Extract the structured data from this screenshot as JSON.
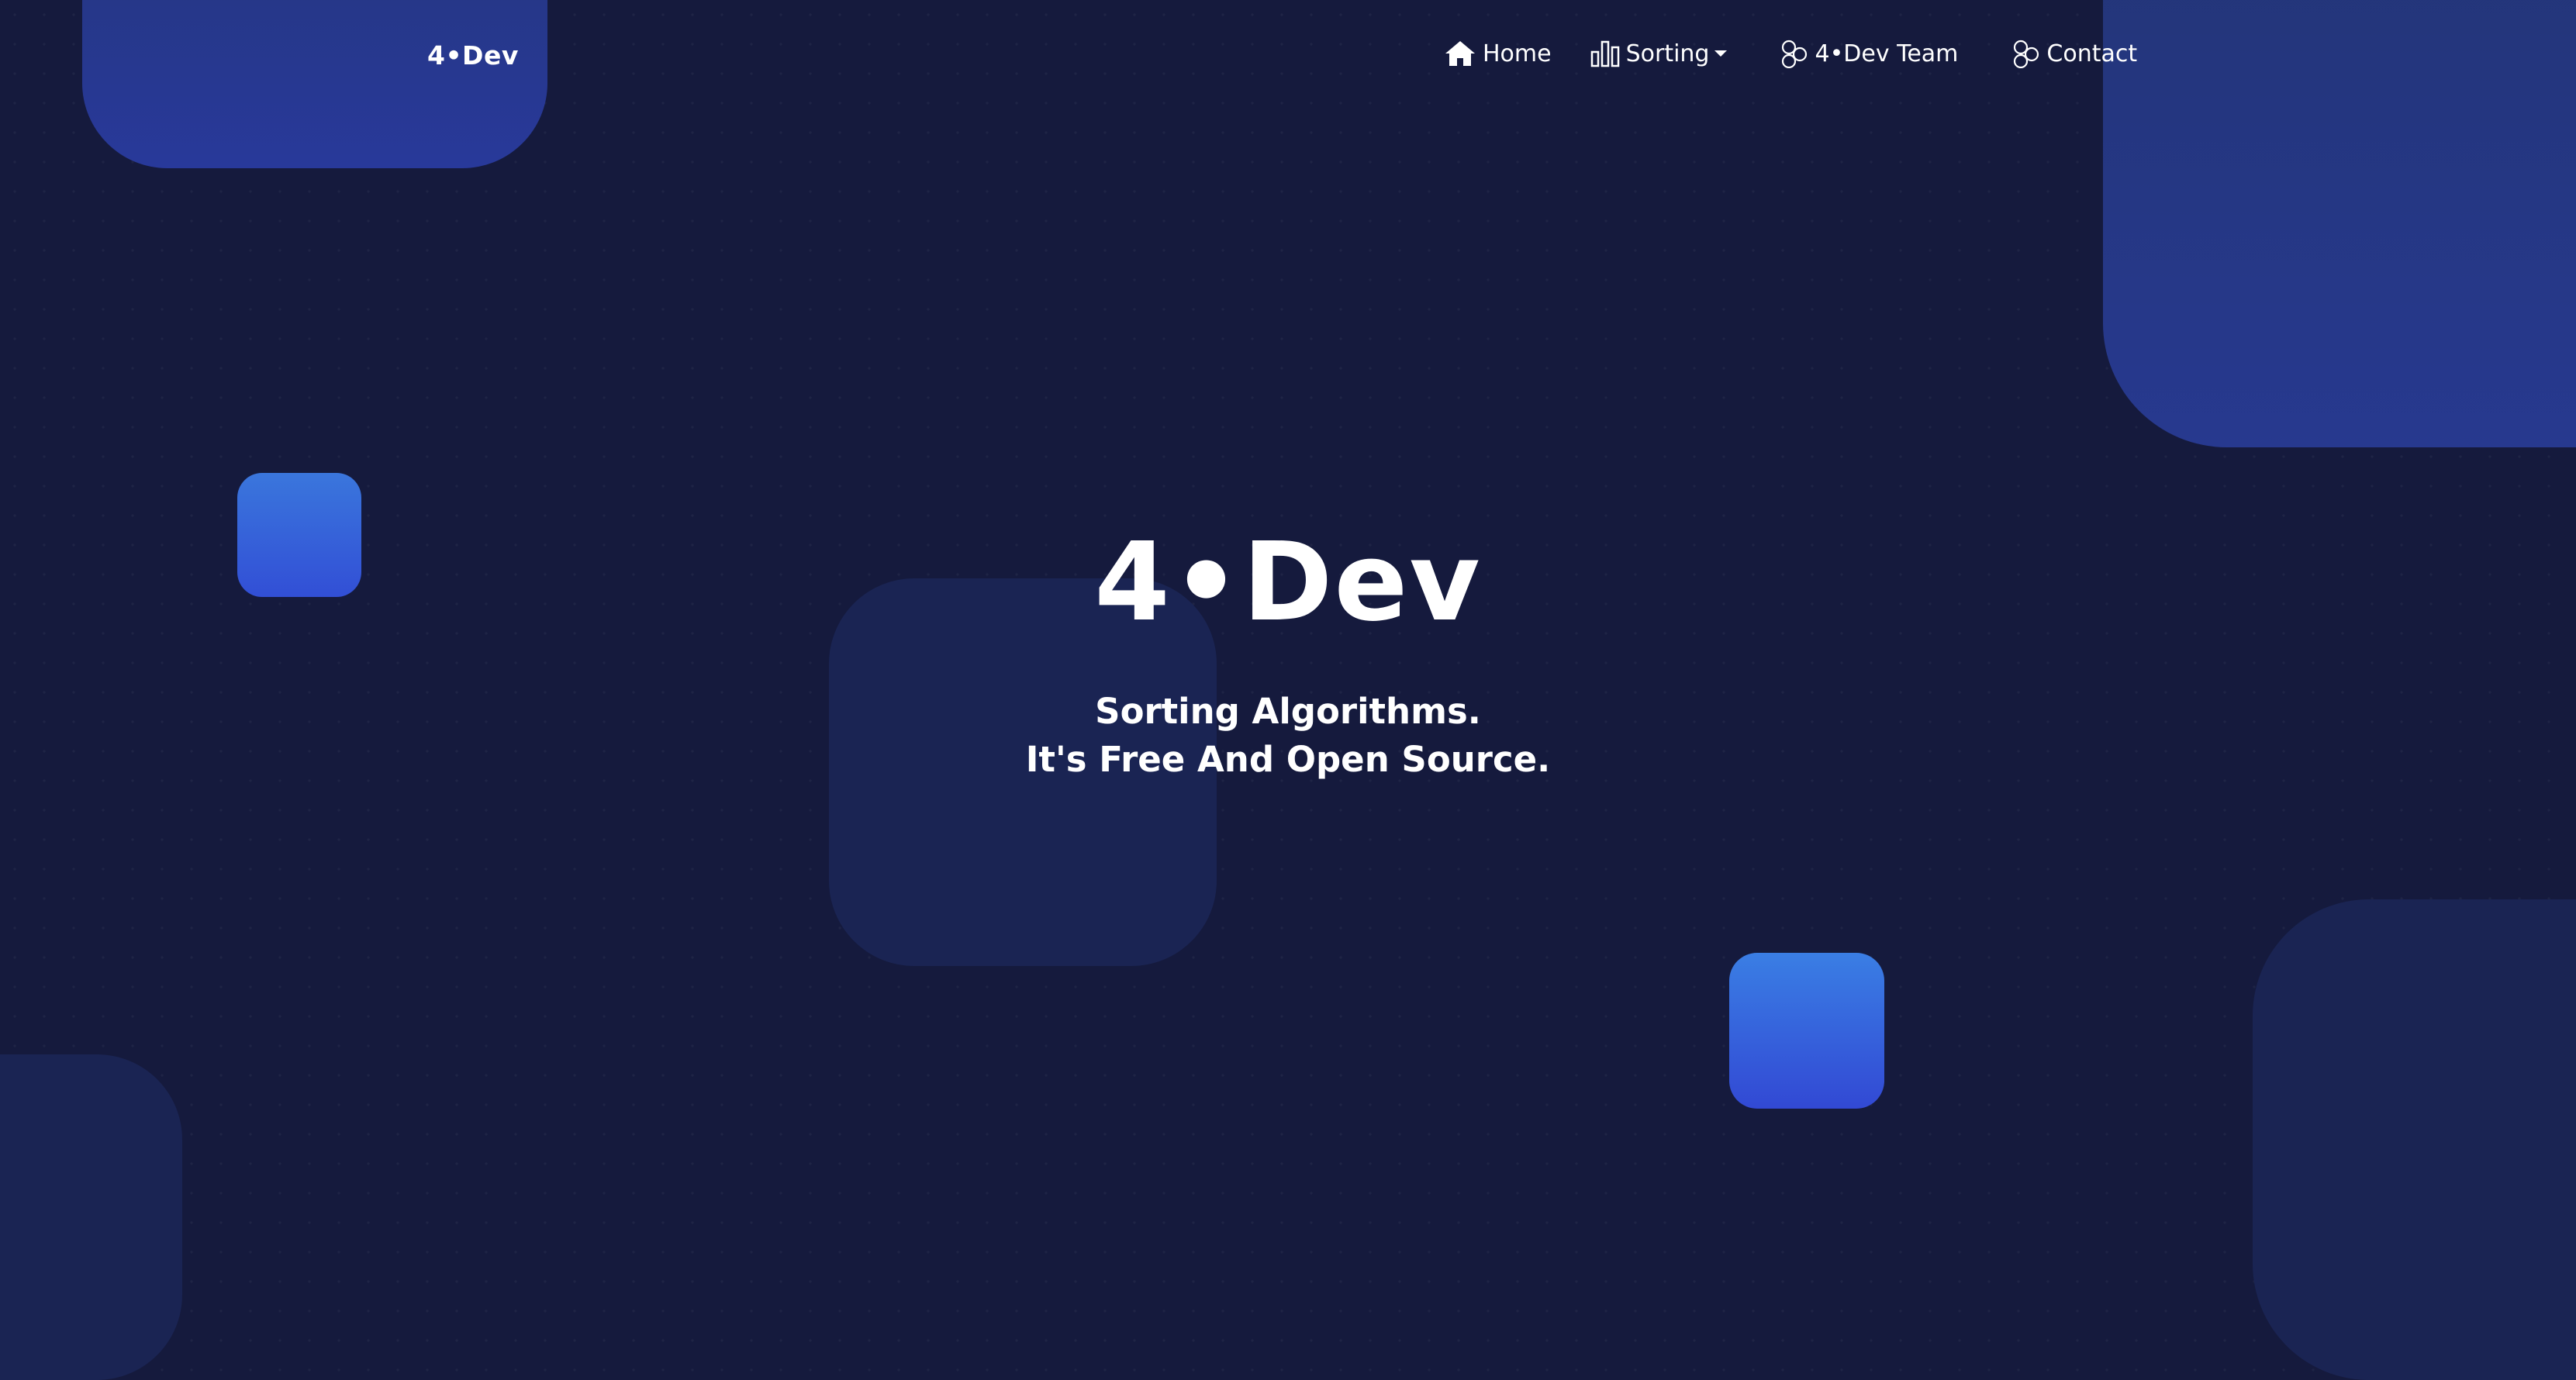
{
  "brand": {
    "logo_text": "4•Dev"
  },
  "nav": {
    "items": [
      {
        "label": "Home",
        "icon": "home-icon"
      },
      {
        "label": "Sorting",
        "icon": "bar-chart-icon",
        "has_dropdown": true
      },
      {
        "label": "4•Dev Team",
        "icon": "team-icon"
      },
      {
        "label": "Contact",
        "icon": "contact-icon"
      }
    ]
  },
  "hero": {
    "title": "4•Dev",
    "tagline_line1": "Sorting Algorithms.",
    "tagline_line2": "It's Free And Open Source."
  },
  "colors": {
    "background": "#151a3d",
    "accent_blue": "#3a76dc",
    "deep_blue": "#27398f",
    "muted_shape": "#1a2453",
    "text": "#ffffff"
  }
}
